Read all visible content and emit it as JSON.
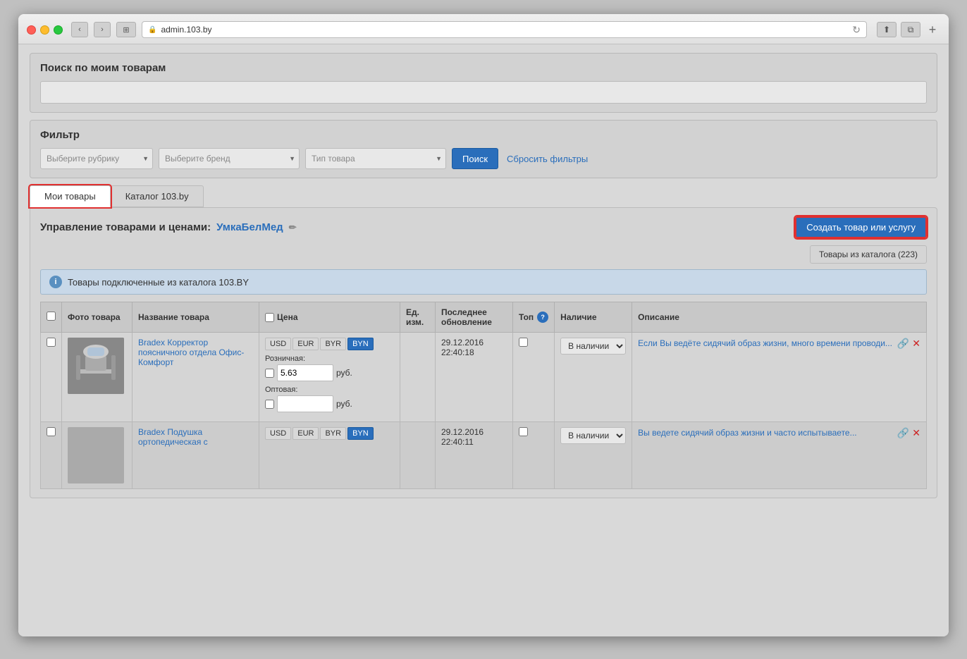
{
  "browser": {
    "url": "admin.103.by",
    "nav_back": "‹",
    "nav_forward": "›"
  },
  "search_section": {
    "title": "Поиск по моим товарам",
    "input_placeholder": ""
  },
  "filter_section": {
    "title": "Фильтр",
    "rubric_placeholder": "Выберите рубрику",
    "brand_placeholder": "Выберите бренд",
    "type_placeholder": "Тип товара",
    "search_btn": "Поиск",
    "reset_btn": "Сбросить фильтры"
  },
  "tabs": {
    "my_goods": "Мои товары",
    "catalog": "Каталог 103.by"
  },
  "management": {
    "title_text": "Управление товарами и ценами:",
    "shop_name": "УмкаБелМед",
    "create_btn": "Создать товар или услугу",
    "catalog_count_btn": "Товары из каталога (223)"
  },
  "info_banner": {
    "text": "Товары подключенные из каталога 103.BY"
  },
  "table": {
    "headers": [
      {
        "key": "checkbox",
        "label": ""
      },
      {
        "key": "photo",
        "label": "Фото товара"
      },
      {
        "key": "name",
        "label": "Название товара"
      },
      {
        "key": "price_checkbox",
        "label": "Цена"
      },
      {
        "key": "unit",
        "label": "Ед. изм."
      },
      {
        "key": "last_update",
        "label": "Последнее обновление"
      },
      {
        "key": "top",
        "label": "Топ"
      },
      {
        "key": "availability",
        "label": "Наличие"
      },
      {
        "key": "description",
        "label": "Описание"
      }
    ],
    "rows": [
      {
        "id": 1,
        "name": "Bradex Корректор поясничного отдела Офис-Комфорт",
        "currencies": [
          "USD",
          "EUR",
          "BYR",
          "BYN"
        ],
        "active_currency": "BYN",
        "retail_price": "5.63",
        "wholesale_price": "",
        "last_update": "29.12.2016 22:40:18",
        "availability": "В наличии",
        "description": "Если Вы ведёте сидячий образ жизни, много времени проводи...",
        "has_photo": true
      },
      {
        "id": 2,
        "name": "Bradex Подушка ортопедическая с",
        "currencies": [
          "USD",
          "EUR",
          "BYR",
          "BYN"
        ],
        "active_currency": "BYN",
        "retail_price": "",
        "wholesale_price": "",
        "last_update": "29.12.2016 22:40:11",
        "availability": "В наличии",
        "description": "Вы ведете сидячий образ жизни и часто испытываете...",
        "has_photo": false
      }
    ],
    "labels": {
      "retail": "Розничная:",
      "wholesale": "Оптовая:",
      "rub": "руб."
    }
  }
}
